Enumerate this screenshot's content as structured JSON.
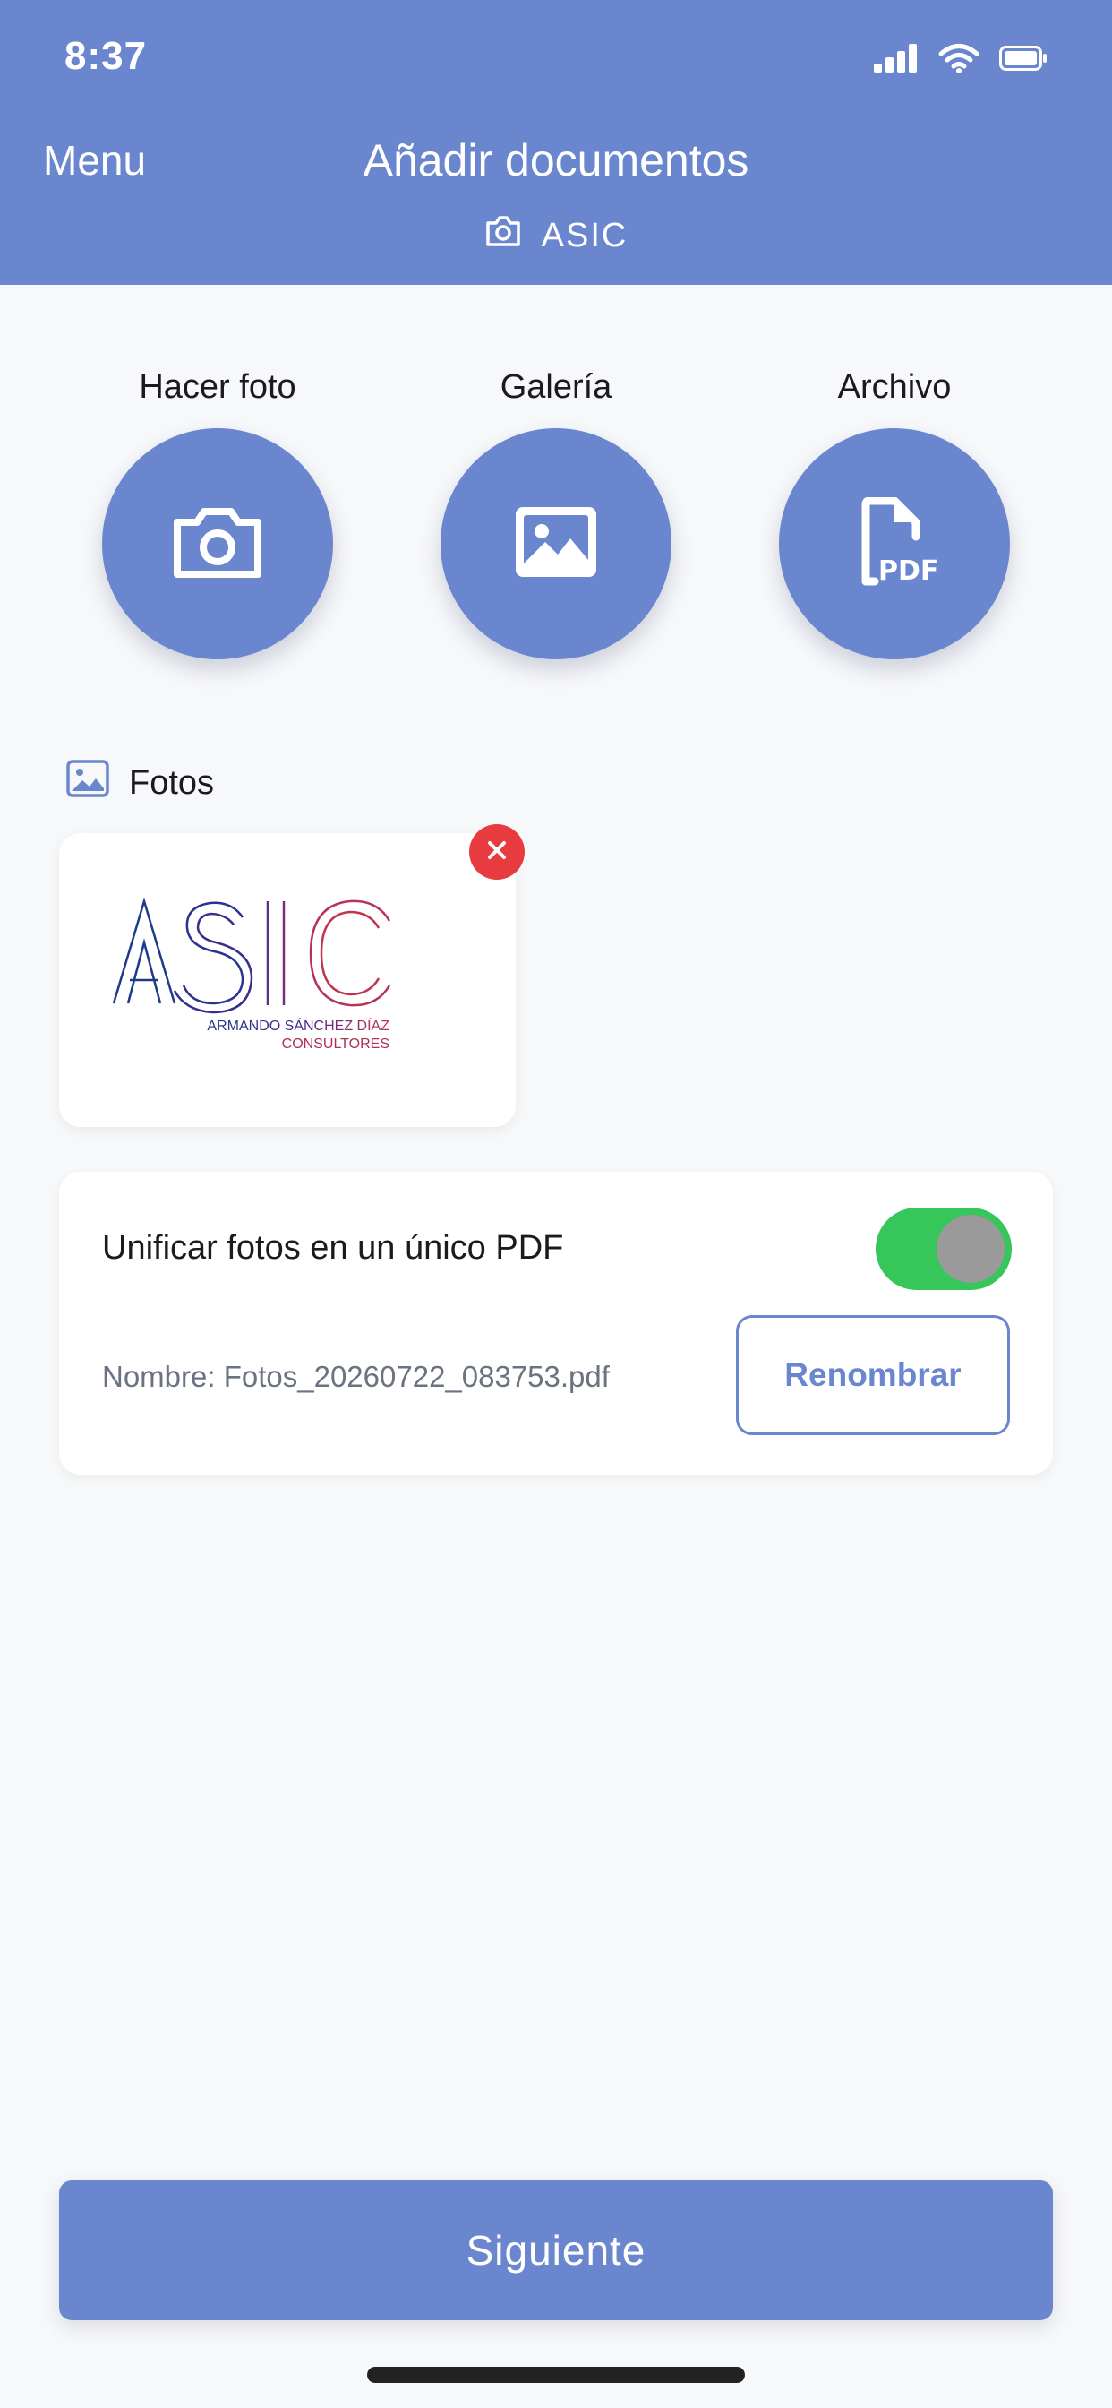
{
  "status_bar": {
    "time": "8:37"
  },
  "nav": {
    "menu_label": "Menu",
    "title": "Añadir documentos",
    "subtitle": "ASIC"
  },
  "actions": [
    {
      "label": "Hacer foto",
      "icon": "camera-icon"
    },
    {
      "label": "Galería",
      "icon": "image-icon"
    },
    {
      "label": "Archivo",
      "icon": "pdf-file-icon"
    }
  ],
  "photos_section": {
    "title": "Fotos",
    "items": [
      {
        "logo_text": "ASIC",
        "logo_line1": "ARMANDO SÁNCHEZ DÍAZ",
        "logo_line2": "CONSULTORES"
      }
    ]
  },
  "options": {
    "unify_label": "Unificar fotos en un único PDF",
    "unify_enabled": true,
    "file_name": "Nombre: Fotos_20260722_083753.pdf",
    "rename_label": "Renombrar"
  },
  "footer": {
    "next_label": "Siguiente"
  },
  "colors": {
    "accent": "#6a86ce",
    "toggle_on": "#36c659",
    "remove": "#e83b3f"
  }
}
